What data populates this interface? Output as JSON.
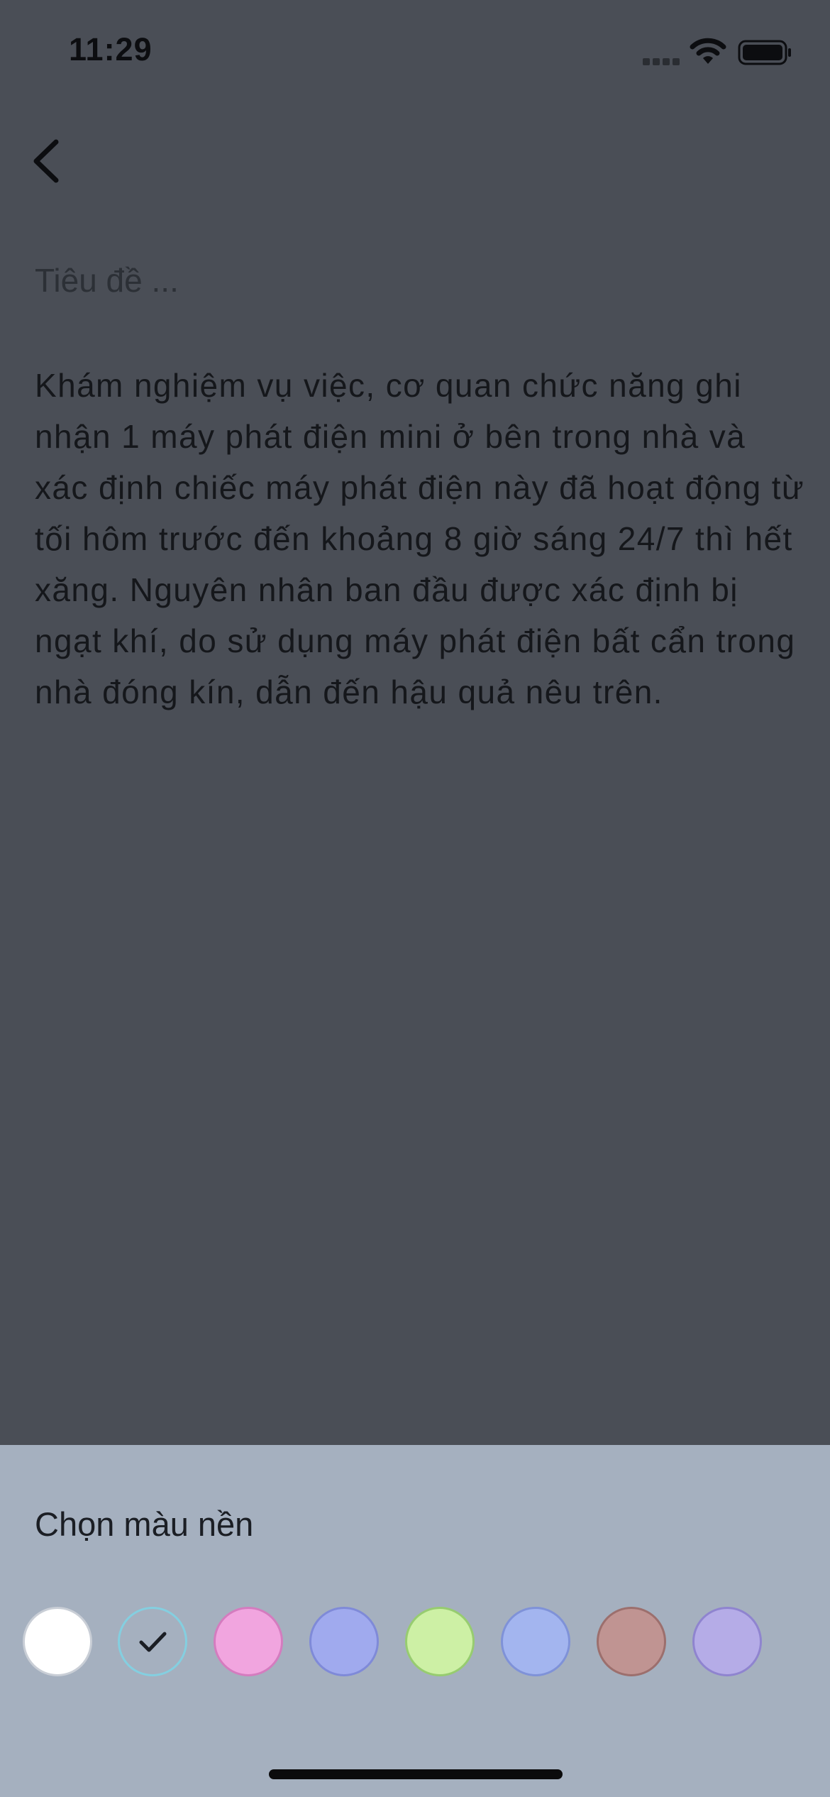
{
  "status_bar": {
    "time": "11:29"
  },
  "editor": {
    "title_placeholder": "Tiêu đề ...",
    "title_value": "",
    "body_text": "Khám nghiệm vụ việc, cơ quan chức năng ghi nhận 1 máy phát điện mini ở bên trong nhà và xác định chiếc máy phát điện này đã hoạt động từ tối hôm trước đến khoảng 8 giờ sáng 24/7 thì hết xăng. Nguyên nhân ban đầu được xác định bị ngạt khí, do sử dụng máy phát điện bất cẩn trong nhà đóng kín, dẫn đến hậu quả nêu trên."
  },
  "color_sheet": {
    "title": "Chọn màu nền",
    "selected_index": 1,
    "colors": [
      {
        "fill": "#ffffff",
        "border": "#c9ced6"
      },
      {
        "fill": "#a5b0bf",
        "border": "#84cfe0"
      },
      {
        "fill": "#f1a5df",
        "border": "#d47cbf"
      },
      {
        "fill": "#a0aaee",
        "border": "#7f8ad8"
      },
      {
        "fill": "#cdf0a5",
        "border": "#97cc70"
      },
      {
        "fill": "#a3b5ef",
        "border": "#7f92d8"
      },
      {
        "fill": "#c09492",
        "border": "#9c6f6d"
      },
      {
        "fill": "#b5ace7",
        "border": "#8f84cf"
      }
    ]
  },
  "icons": {
    "back": "chevron-left-icon",
    "wifi": "wifi-icon",
    "battery": "battery-icon",
    "signal": "signal-icon",
    "selected": "checkmark-icon"
  }
}
